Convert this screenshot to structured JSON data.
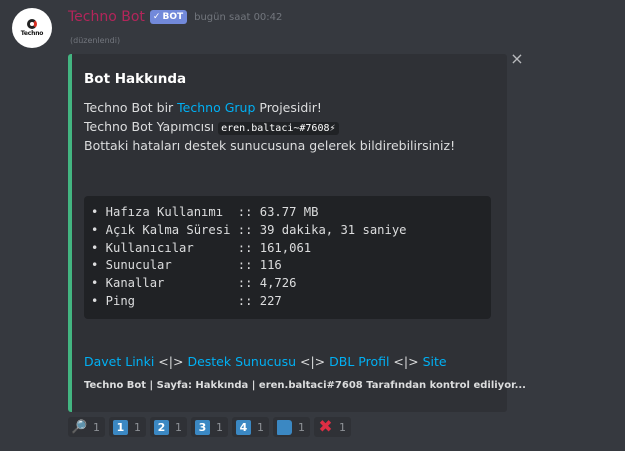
{
  "message": {
    "avatar_text": "Techno",
    "username": "Techno Bot",
    "bot_tag": "BOT",
    "timestamp": "bugün saat 00:42",
    "edited_label": "(düzenlendi)"
  },
  "embed": {
    "accent_color": "#43b581",
    "title": "Bot Hakkında",
    "line1_prefix": "Techno Bot bir ",
    "line1_link": "Techno Grup",
    "line1_suffix": " Projesidir!",
    "line2_prefix": "Techno Bot Yapımcısı ",
    "line2_code": "eren.baltaci~#7608⚡",
    "line3": "Bottaki hataları destek sunucusuna gelerek bildirebilirsiniz!",
    "stats": [
      "• Hafıza Kullanımı  :: 63.77 MB",
      "• Açık Kalma Süresi :: 39 dakika, 31 saniye",
      "• Kullanıcılar      :: 161,061",
      "• Sunucular         :: 116",
      "• Kanallar          :: 4,726",
      "• Ping              :: 227"
    ],
    "links": {
      "invite": "Davet Linki",
      "sep1": " <|> ",
      "support": "Destek Sunucusu",
      "sep2": " <|> ",
      "dbl": "DBL Profil",
      "sep3": " <|> ",
      "site": "Site"
    },
    "footer": "Techno Bot | Sayfa: Hakkında | eren.baltaci#7608 Tarafından kontrol ediliyor..."
  },
  "reactions": [
    {
      "emoji": "🔎",
      "icon": "magnifier-icon",
      "count": "1"
    },
    {
      "emoji": "1",
      "icon": "keycap-1-icon",
      "count": "1"
    },
    {
      "emoji": "2",
      "icon": "keycap-2-icon",
      "count": "1"
    },
    {
      "emoji": "3",
      "icon": "keycap-3-icon",
      "count": "1"
    },
    {
      "emoji": "4",
      "icon": "keycap-4-icon",
      "count": "1"
    },
    {
      "emoji": "",
      "icon": "blue-book-icon",
      "count": "1"
    },
    {
      "emoji": "✖",
      "icon": "cross-mark-icon",
      "count": "1"
    }
  ]
}
